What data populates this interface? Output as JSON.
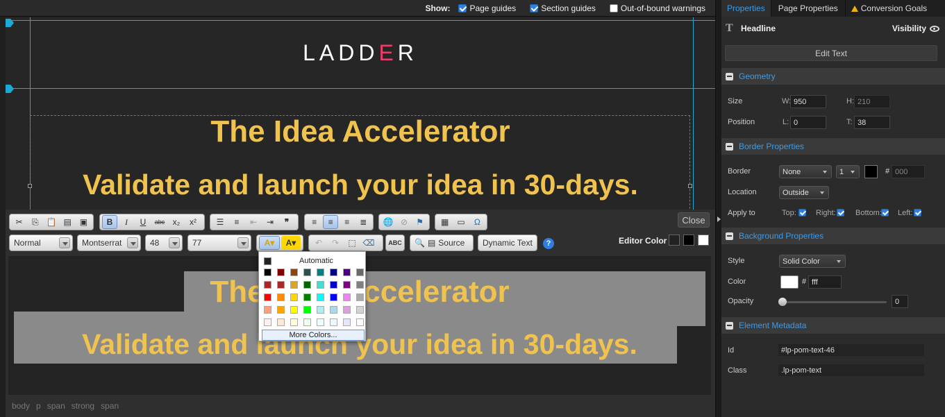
{
  "show_bar": {
    "label": "Show:",
    "options": [
      {
        "label": "Page guides",
        "checked": true
      },
      {
        "label": "Section guides",
        "checked": true
      },
      {
        "label": "Out-of-bound warnings",
        "checked": false
      }
    ]
  },
  "canvas": {
    "logo_prefix": "LADD",
    "logo_accent": "E",
    "logo_suffix": "R",
    "headline_line1": "The Idea Accelerator",
    "headline_line2": "Validate and launch your idea in 30-days.",
    "headline_color": "#f0c34f"
  },
  "editor": {
    "format_value": "Normal",
    "font_value": "Montserrat",
    "size_value": "48",
    "line_height_value": "77",
    "source_label": "Source",
    "dynamic_text_label": "Dynamic Text",
    "help_label": "?",
    "close_label": "Close",
    "editor_color_label": "Editor Color",
    "editor_colors": [
      "#222222",
      "#000000",
      "#ffffff"
    ],
    "content_line1": "The Idea Accelerator",
    "content_line2": "Validate and launch your idea in 30-days.",
    "color_popup": {
      "automatic_label": "Automatic",
      "more_colors_label": "More Colors...",
      "colors": [
        "#000000",
        "#800000",
        "#8b4513",
        "#2f4f4f",
        "#008080",
        "#000080",
        "#4b0082",
        "#696969",
        "#b22222",
        "#a52a2a",
        "#daa520",
        "#006400",
        "#40e0d0",
        "#0000cd",
        "#800080",
        "#808080",
        "#ff0000",
        "#ff8c00",
        "#ffd700",
        "#008000",
        "#00ffff",
        "#0000ff",
        "#ee82ee",
        "#a9a9a9",
        "#ffa07a",
        "#ffa500",
        "#ffff00",
        "#00ff00",
        "#afeeee",
        "#add8e6",
        "#dda0dd",
        "#d3d3d3",
        "#fff0f5",
        "#faebd7",
        "#ffffe0",
        "#f0fff0",
        "#f0ffff",
        "#f0f8ff",
        "#e6e6fa",
        "#ffffff"
      ]
    },
    "path": [
      "body",
      "p",
      "span",
      "strong",
      "span"
    ]
  },
  "panel": {
    "tabs": [
      {
        "label": "Properties",
        "active": true
      },
      {
        "label": "Page Properties",
        "active": false
      },
      {
        "label": "Conversion Goals",
        "active": false,
        "warning": true
      }
    ],
    "element_name": "Headline",
    "visibility_label": "Visibility",
    "edit_text_label": "Edit Text",
    "geometry": {
      "title": "Geometry",
      "size_label": "Size",
      "w_label": "W:",
      "w_value": "950",
      "h_label": "H:",
      "h_value": "210",
      "position_label": "Position",
      "l_label": "L:",
      "l_value": "0",
      "t_label": "T:",
      "t_value": "38"
    },
    "border": {
      "title": "Border Properties",
      "border_label": "Border",
      "style_value": "None",
      "width_value": "1",
      "color_hash": "#",
      "color_value": "000",
      "location_label": "Location",
      "location_value": "Outside",
      "apply_label": "Apply to",
      "top_label": "Top:",
      "right_label": "Right:",
      "bottom_label": "Bottom:",
      "left_label": "Left:"
    },
    "background": {
      "title": "Background Properties",
      "style_label": "Style",
      "style_value": "Solid Color",
      "color_label": "Color",
      "color_hash": "#",
      "color_value": "fff",
      "opacity_label": "Opacity",
      "opacity_value": "0"
    },
    "metadata": {
      "title": "Element Metadata",
      "id_label": "Id",
      "id_value": "#lp-pom-text-46",
      "class_label": "Class",
      "class_value": ".lp-pom-text"
    }
  }
}
